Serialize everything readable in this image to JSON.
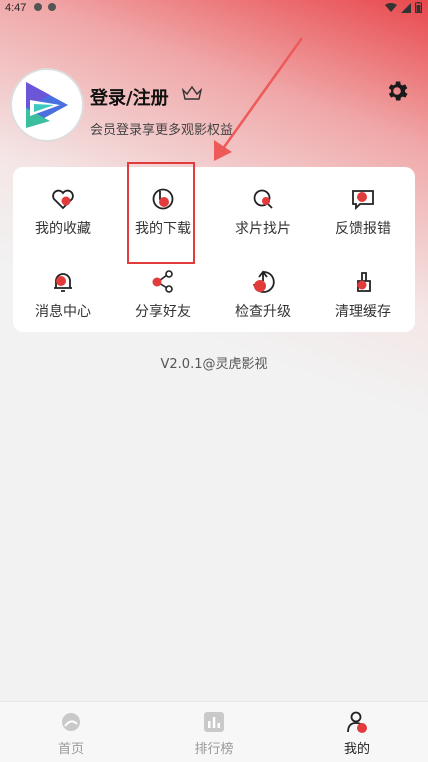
{
  "status": {
    "time": "4:47"
  },
  "profile": {
    "title": "登录/注册",
    "subtitle": "会员登录享更多观影权益"
  },
  "menu": [
    {
      "label": "我的收藏",
      "icon": "heart-icon"
    },
    {
      "label": "我的下载",
      "icon": "download-icon"
    },
    {
      "label": "求片找片",
      "icon": "search-movie-icon"
    },
    {
      "label": "反馈报错",
      "icon": "feedback-icon"
    },
    {
      "label": "消息中心",
      "icon": "bell-icon"
    },
    {
      "label": "分享好友",
      "icon": "share-icon"
    },
    {
      "label": "检查升级",
      "icon": "upgrade-icon"
    },
    {
      "label": "清理缓存",
      "icon": "broom-icon"
    }
  ],
  "version_text": "V2.0.1@灵虎影视",
  "tabs": [
    {
      "label": "首页",
      "icon": "home-icon"
    },
    {
      "label": "排行榜",
      "icon": "ranking-icon"
    },
    {
      "label": "我的",
      "icon": "profile-icon"
    }
  ],
  "colors": {
    "accent": "#e23b3b",
    "brand_teal": "#3bbf9e",
    "brand_blue": "#3a7fe0"
  }
}
